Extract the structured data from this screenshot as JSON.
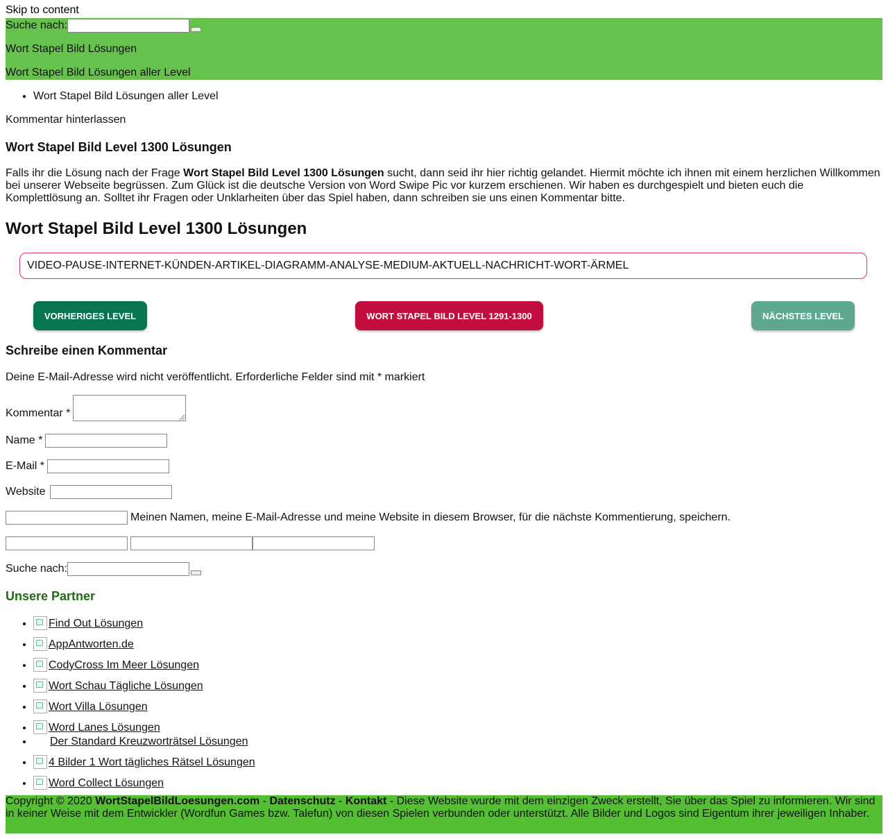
{
  "skip_link": "Skip to content",
  "header": {
    "search_label": "Suche nach:",
    "site_title": "Wort Stapel Bild Lösungen",
    "site_description": "Wort Stapel Bild Lösungen aller Level",
    "accent_color": "#66c14d"
  },
  "breadcrumb": {
    "items": [
      "Wort Stapel Bild Lösungen aller Level"
    ]
  },
  "leave_comment": "Kommentar hinterlassen",
  "article": {
    "small_title": "Wort Stapel Bild Level 1300 Lösungen",
    "intro_before": "Falls ihr die Lösung nach der Frage ",
    "intro_bold": "Wort Stapel Bild Level 1300 Lösungen",
    "intro_after": " sucht, dann seid ihr hier richtig gelandet. Hiermit möchte ich ihnen mit einem herzlichen Willkommen bei unserer Webseite begrüssen. Zum Glück ist die deutsche Version von Word Swipe Pic vor kurzem erschienen. Wir haben es durchgespielt und bieten euch die Komplettlösung an. Solltet ihr Fragen oder Unklarheiten über das Spiel haben, dann schreiben sie uns einen Kommentar bitte.",
    "big_title": "Wort Stapel Bild Level 1300 Lösungen",
    "answer": "VIDEO-PAUSE-INTERNET-KÜNDEN-ARTIKEL-DIAGRAMM-ANALYSE-MEDIUM-AKTUELL-NACHRICHT-WORT-ÄRMEL"
  },
  "nav_buttons": {
    "prev": "VORHERIGES LEVEL",
    "middle": "WORT STAPEL BILD LEVEL 1291-1300",
    "next": "NÄCHSTES LEVEL",
    "colors": {
      "prev": "#087552",
      "middle": "#c20e3e",
      "next": "#5ea890"
    }
  },
  "comment_form": {
    "title": "Schreibe einen Kommentar",
    "notes": "Deine E-Mail-Adresse wird nicht veröffentlicht. Erforderliche Felder sind mit * markiert",
    "comment_label": "Kommentar *",
    "name_label": "Name *",
    "email_label": "E-Mail *",
    "website_label": "Website",
    "cookies_label": "Meinen Namen, meine E-Mail-Adresse und meine Website in diesem Browser, für die nächste Kommentierung, speichern."
  },
  "sidebar": {
    "search_label": "Suche nach:",
    "partners_title": "Unsere Partner",
    "partners_color": "#1e6b12",
    "partners": [
      {
        "label": "Find Out Lösungen",
        "has_image": true
      },
      {
        "label": "AppAntworten.de",
        "has_image": true
      },
      {
        "label": "CodyCross Im Meer Lösungen",
        "has_image": true
      },
      {
        "label": "Wort Schau Tägliche Lösungen",
        "has_image": true
      },
      {
        "label": "Wort Villa Lösungen",
        "has_image": true
      },
      {
        "label": "Word Lanes Lösungen",
        "has_image": true
      },
      {
        "label": "Der Standard Kreuzworträtsel Lösungen",
        "has_image": false
      },
      {
        "label": "4 Bilder 1 Wort tägliches Rätsel Lösungen",
        "has_image": true
      },
      {
        "label": "Word Collect Lösungen",
        "has_image": true
      }
    ]
  },
  "footer": {
    "copyright": "Copyright © 2020 ",
    "site_link": "WortStapelBildLoesungen.com",
    "sep1": " - ",
    "privacy": "Datenschutz",
    "sep2": " - ",
    "contact": "Kontakt",
    "disclaimer": " - Diese Website wurde mit dem einzigen Zweck erstellt, Sie über das Spiel zu informieren. Wir sind in keiner Weise mit dem Entwickler (Wordfun Games bzw. Talefun) von diesen Spielen verbunden oder unterstützt. Alle Bilder und Logos sind Eigentum ihrer jeweiligen Inhaber.",
    "background": "#54bf33"
  }
}
